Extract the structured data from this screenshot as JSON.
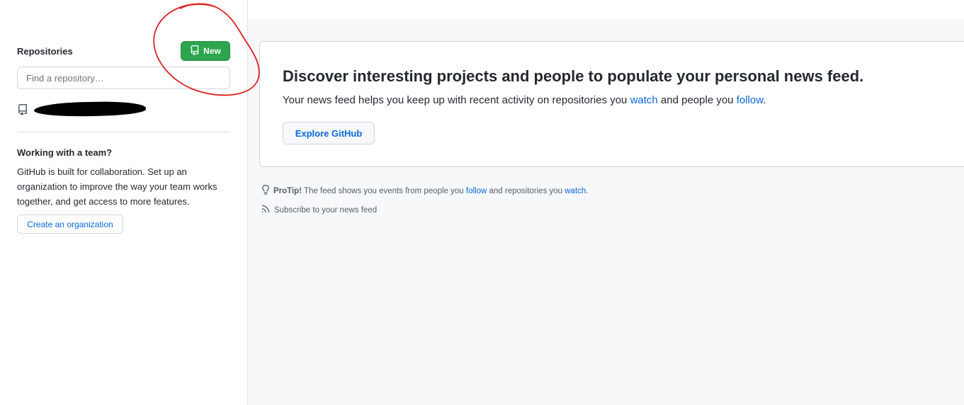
{
  "sidebar": {
    "repositories_title": "Repositories",
    "new_button_label": "New",
    "find_placeholder": "Find a repository…",
    "team_title": "Working with a team?",
    "team_text": "GitHub is built for collaboration. Set up an organization to improve the way your team works together, and get access to more features.",
    "create_org_label": "Create an organization"
  },
  "main": {
    "card": {
      "title": "Discover interesting projects and people to populate your personal news feed.",
      "desc_prefix": "Your news feed helps you keep up with recent activity on repositories you ",
      "desc_link_watch": "watch",
      "desc_middle": " and people you ",
      "desc_link_follow": "follow",
      "desc_suffix": ".",
      "explore_label": "Explore GitHub"
    },
    "protip": {
      "label": "ProTip!",
      "text_prefix": " The feed shows you events from people you ",
      "link_follow": "follow",
      "text_middle": " and repositories you ",
      "link_watch": "watch",
      "text_suffix": "."
    },
    "subscribe_label": "Subscribe to your news feed"
  },
  "colors": {
    "accent_link": "#0969da",
    "new_button": "#2da44e",
    "annotation_circle": "#e02020",
    "main_background": "#f6f8fa"
  },
  "icons": [
    "repo-icon",
    "light-bulb-icon",
    "rss-icon"
  ]
}
